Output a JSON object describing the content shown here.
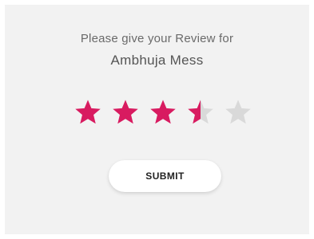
{
  "review": {
    "prompt": "Please give your Review for",
    "place_name": "Ambhuja Mess"
  },
  "rating": {
    "value": 3.5,
    "max": 5,
    "filled_color": "#d81b60",
    "empty_color": "#d9d9d9"
  },
  "actions": {
    "submit_label": "SUBMIT"
  }
}
